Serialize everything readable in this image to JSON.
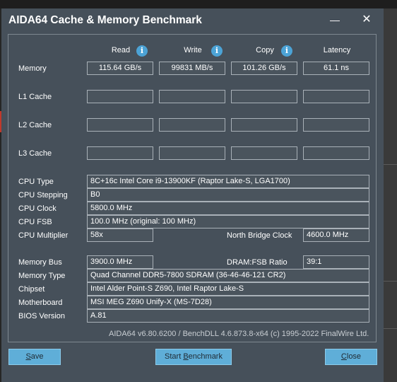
{
  "window": {
    "title": "AIDA64 Cache & Memory Benchmark",
    "minimize_icon": "minimize-icon",
    "close_icon": "close-icon"
  },
  "headers": {
    "read": "Read",
    "write": "Write",
    "copy": "Copy",
    "latency": "Latency",
    "info_icon": "info-icon"
  },
  "rows": {
    "memory": {
      "label": "Memory",
      "read": "115.64 GB/s",
      "write": "99831 MB/s",
      "copy": "101.26 GB/s",
      "latency": "61.1 ns"
    },
    "l1": {
      "label": "L1 Cache",
      "read": "",
      "write": "",
      "copy": "",
      "latency": ""
    },
    "l2": {
      "label": "L2 Cache",
      "read": "",
      "write": "",
      "copy": "",
      "latency": ""
    },
    "l3": {
      "label": "L3 Cache",
      "read": "",
      "write": "",
      "copy": "",
      "latency": ""
    }
  },
  "cpu": {
    "type_label": "CPU Type",
    "type": "8C+16c Intel Core i9-13900KF  (Raptor Lake-S, LGA1700)",
    "stepping_label": "CPU Stepping",
    "stepping": "B0",
    "clock_label": "CPU Clock",
    "clock": "5800.0 MHz",
    "fsb_label": "CPU FSB",
    "fsb": "100.0 MHz  (original: 100 MHz)",
    "multiplier_label": "CPU Multiplier",
    "multiplier": "58x",
    "nb_clock_label": "North Bridge Clock",
    "nb_clock": "4600.0 MHz"
  },
  "memory_info": {
    "bus_label": "Memory Bus",
    "bus": "3900.0 MHz",
    "ratio_label": "DRAM:FSB Ratio",
    "ratio": "39:1",
    "type_label": "Memory Type",
    "type": "Quad Channel DDR5-7800 SDRAM  (36-46-46-121 CR2)",
    "chipset_label": "Chipset",
    "chipset": "Intel Alder Point-S Z690, Intel Raptor Lake-S",
    "motherboard_label": "Motherboard",
    "motherboard": "MSI MEG Z690 Unify-X (MS-7D28)",
    "bios_label": "BIOS Version",
    "bios": "A.81"
  },
  "footer": "AIDA64 v6.80.6200 / BenchDLL 4.6.873.8-x64  (c) 1995-2022 FinalWire Ltd.",
  "buttons": {
    "save_mnemonic": "S",
    "save_rest": "ave",
    "start_pre": "Start ",
    "start_mnemonic": "B",
    "start_rest": "enchmark",
    "close_mnemonic": "C",
    "close_rest": "lose"
  }
}
